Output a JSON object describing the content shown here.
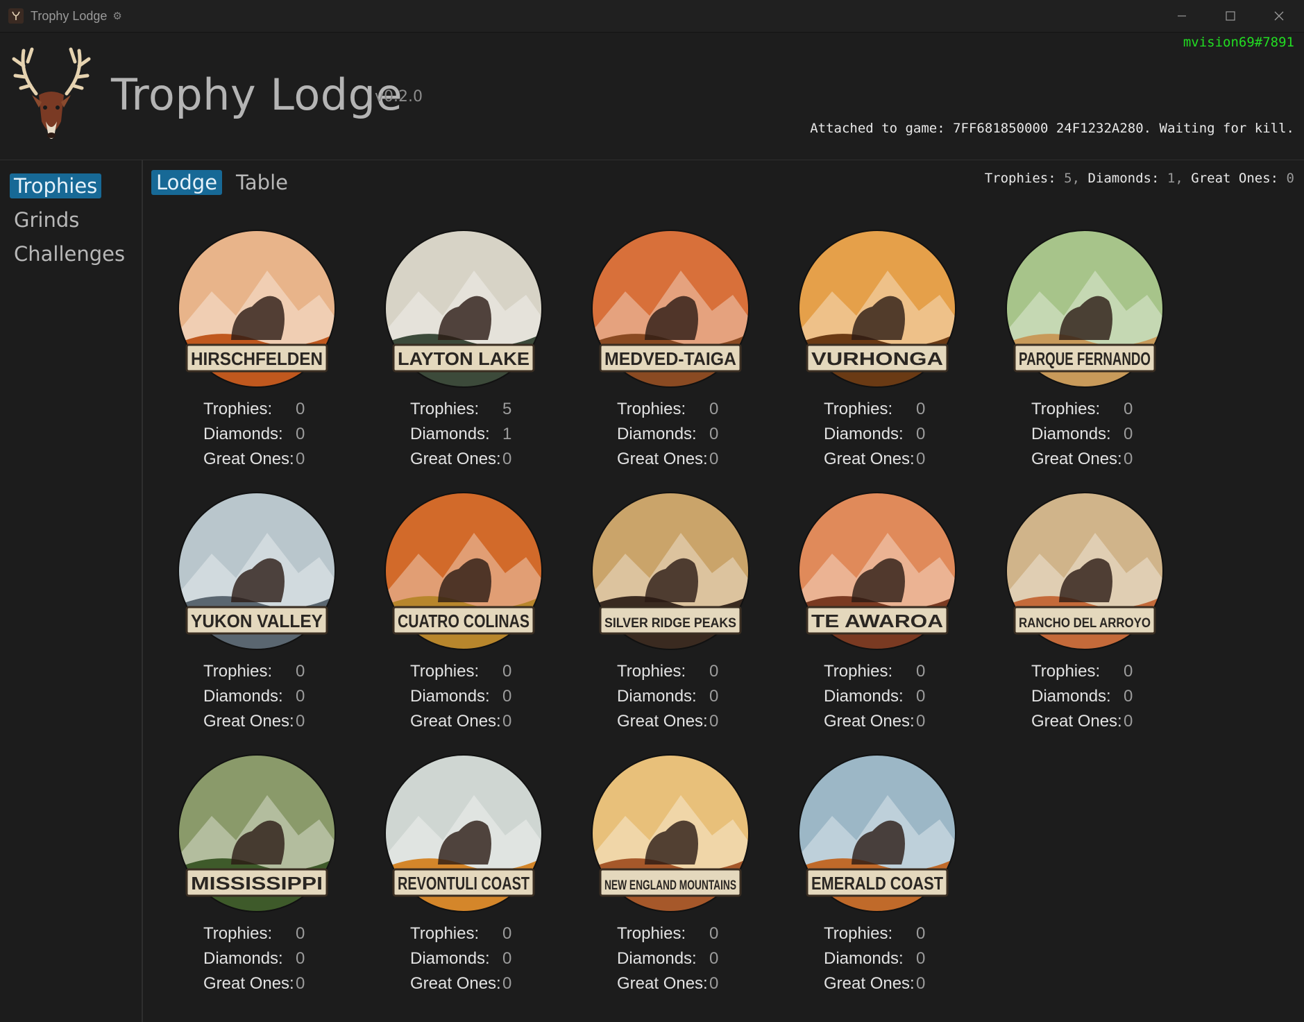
{
  "window": {
    "title": "Trophy Lodge",
    "controls": [
      "minimize",
      "maximize",
      "close"
    ]
  },
  "header": {
    "app_name": "Trophy Lodge",
    "version": "v0.2.0",
    "user": "mvision69#7891",
    "status": "Attached to game: 7FF681850000 24F1232A280. Waiting for kill."
  },
  "sidebar": {
    "items": [
      {
        "label": "Trophies",
        "active": true
      },
      {
        "label": "Grinds",
        "active": false
      },
      {
        "label": "Challenges",
        "active": false
      }
    ]
  },
  "tabs": [
    {
      "label": "Lodge",
      "active": true
    },
    {
      "label": "Table",
      "active": false
    }
  ],
  "summary": {
    "trophies_label": "Trophies:",
    "trophies": "5",
    "diamonds_label": "Diamonds:",
    "diamonds": "1",
    "great_ones_label": "Great Ones:",
    "great_ones": "0"
  },
  "stat_labels": {
    "trophies": "Trophies:",
    "diamonds": "Diamonds:",
    "great_ones": "Great Ones:"
  },
  "reserves": [
    {
      "name": "HIRSCHFELDEN",
      "trophies": "0",
      "diamonds": "0",
      "great_ones": "0",
      "sky": "#e8b48a",
      "ground": "#c0581e",
      "icon": "red-deer-icon"
    },
    {
      "name": "LAYTON LAKE",
      "trophies": "5",
      "diamonds": "1",
      "great_ones": "0",
      "sky": "#d7d3c6",
      "ground": "#3c4a3a",
      "icon": "mountain-icon"
    },
    {
      "name": "MEDVED-TAIGA",
      "trophies": "0",
      "diamonds": "0",
      "great_ones": "0",
      "sky": "#d8703a",
      "ground": "#8a4a22",
      "icon": "bear-icon"
    },
    {
      "name": "VURHONGA",
      "trophies": "0",
      "diamonds": "0",
      "great_ones": "0",
      "sky": "#e5a04a",
      "ground": "#6a3a14",
      "icon": "lion-icon"
    },
    {
      "name": "PARQUE FERNANDO",
      "trophies": "0",
      "diamonds": "0",
      "great_ones": "0",
      "sky": "#a7c48a",
      "ground": "#c89a5a",
      "icon": "jaguar-icon"
    },
    {
      "name": "YUKON VALLEY",
      "trophies": "0",
      "diamonds": "0",
      "great_ones": "0",
      "sky": "#b9c6cc",
      "ground": "#5a6670",
      "icon": "wolf-icon"
    },
    {
      "name": "CUATRO COLINAS",
      "trophies": "0",
      "diamonds": "0",
      "great_ones": "0",
      "sky": "#d26a2a",
      "ground": "#b8862c",
      "icon": "ibex-icon"
    },
    {
      "name": "SILVER RIDGE PEAKS",
      "trophies": "0",
      "diamonds": "0",
      "great_ones": "0",
      "sky": "#caa46a",
      "ground": "#3a2a20",
      "icon": "bison-icon"
    },
    {
      "name": "TE AWAROA",
      "trophies": "0",
      "diamonds": "0",
      "great_ones": "0",
      "sky": "#e08a5a",
      "ground": "#7a3a22",
      "icon": "deer-icon"
    },
    {
      "name": "RANCHO DEL ARROYO",
      "trophies": "0",
      "diamonds": "0",
      "great_ones": "0",
      "sky": "#d0b48a",
      "ground": "#c46a3a",
      "icon": "ram-icon"
    },
    {
      "name": "MISSISSIPPI",
      "trophies": "0",
      "diamonds": "0",
      "great_ones": "0",
      "sky": "#8a9a6a",
      "ground": "#3e5a2a",
      "icon": "alligator-icon"
    },
    {
      "name": "REVONTULI COAST",
      "trophies": "0",
      "diamonds": "0",
      "great_ones": "0",
      "sky": "#cfd6d2",
      "ground": "#d4862a",
      "icon": "goose-icon"
    },
    {
      "name": "NEW ENGLAND MOUNTAINS",
      "trophies": "0",
      "diamonds": "0",
      "great_ones": "0",
      "sky": "#e8c07a",
      "ground": "#a6582a",
      "icon": "moose-icon"
    },
    {
      "name": "EMERALD COAST",
      "trophies": "0",
      "diamonds": "0",
      "great_ones": "0",
      "sky": "#9cb7c6",
      "ground": "#c06a2a",
      "icon": "kangaroo-icon"
    }
  ]
}
